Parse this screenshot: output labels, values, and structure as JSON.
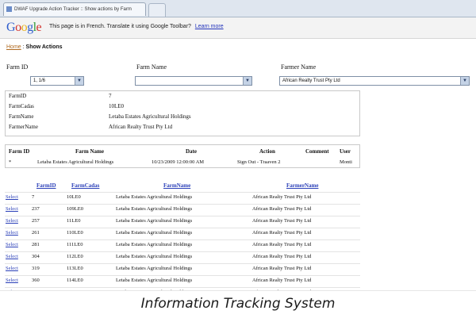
{
  "browser": {
    "tab_title": "DWAF Upgrade Action Tracker :: Show actions by Farm"
  },
  "translate_bar": {
    "logo": "Google",
    "message": "This page is in French.  Translate it using Google Toolbar?",
    "link": "Learn more"
  },
  "breadcrumb": {
    "home": "Home",
    "separator": " : ",
    "current": "Show Actions"
  },
  "filters": {
    "farm_id_label": "Farm ID",
    "farm_id_value": "1, 1/6",
    "farm_name_label": "Farm Name",
    "farm_name_value": "",
    "farmer_name_label": "Farmer Name",
    "farmer_name_value": "African Realty Trust Pty Ltd"
  },
  "details": [
    {
      "label": "FarmID",
      "value": "7"
    },
    {
      "label": "FarmCadas",
      "value": "10LE0"
    },
    {
      "label": "FarmName",
      "value": "Letaba Estates Agricultural Holdings"
    },
    {
      "label": "FarmerName",
      "value": "African Realty Trust Pty Ltd"
    }
  ],
  "actions_table": {
    "headers": [
      "Farm ID",
      "Farm Name",
      "Date",
      "Action",
      "Comment",
      "User"
    ],
    "rows": [
      [
        "*",
        "Letaba Estates Agricultural Holdings",
        "10/23/2009 12:00:00 AM",
        "Sign Out - Traaven 2",
        "",
        "Monti"
      ]
    ]
  },
  "grid": {
    "select_label": "Select",
    "headers": [
      "FarmID",
      "FarmCadas",
      "FarmName",
      "FarmerName"
    ],
    "rows": [
      [
        "7",
        "10LE0",
        "Letaba Estates Agricultural Holdings",
        "African Realty Trust Pty Ltd"
      ],
      [
        "237",
        "109LE0",
        "Letaba Estates Agricultural Holdings",
        "African Realty Trust Pty Ltd"
      ],
      [
        "257",
        "11LE0",
        "Letaba Estates Agricultural Holdings",
        "African Realty Trust Pty Ltd"
      ],
      [
        "261",
        "110LE0",
        "Letaba Estates Agricultural Holdings",
        "African Realty Trust Pty Ltd"
      ],
      [
        "281",
        "111LE0",
        "Letaba Estates Agricultural Holdings",
        "African Realty Trust Pty Ltd"
      ],
      [
        "304",
        "112LE0",
        "Letaba Estates Agricultural Holdings",
        "African Realty Trust Pty Ltd"
      ],
      [
        "319",
        "113LE0",
        "Letaba Estates Agricultural Holdings",
        "African Realty Trust Pty Ltd"
      ],
      [
        "360",
        "114LE0",
        "Letaba Estates Agricultural Holdings",
        "African Realty Trust Pty Ltd"
      ],
      [
        "369",
        "115LE0",
        "Letaba Estates Agricultural Holdings",
        "African Realty Trust Pty Ltd"
      ]
    ]
  },
  "caption": "Information Tracking System",
  "colors": {
    "link": "#2a3fb8",
    "home_link": "#b06a20"
  }
}
